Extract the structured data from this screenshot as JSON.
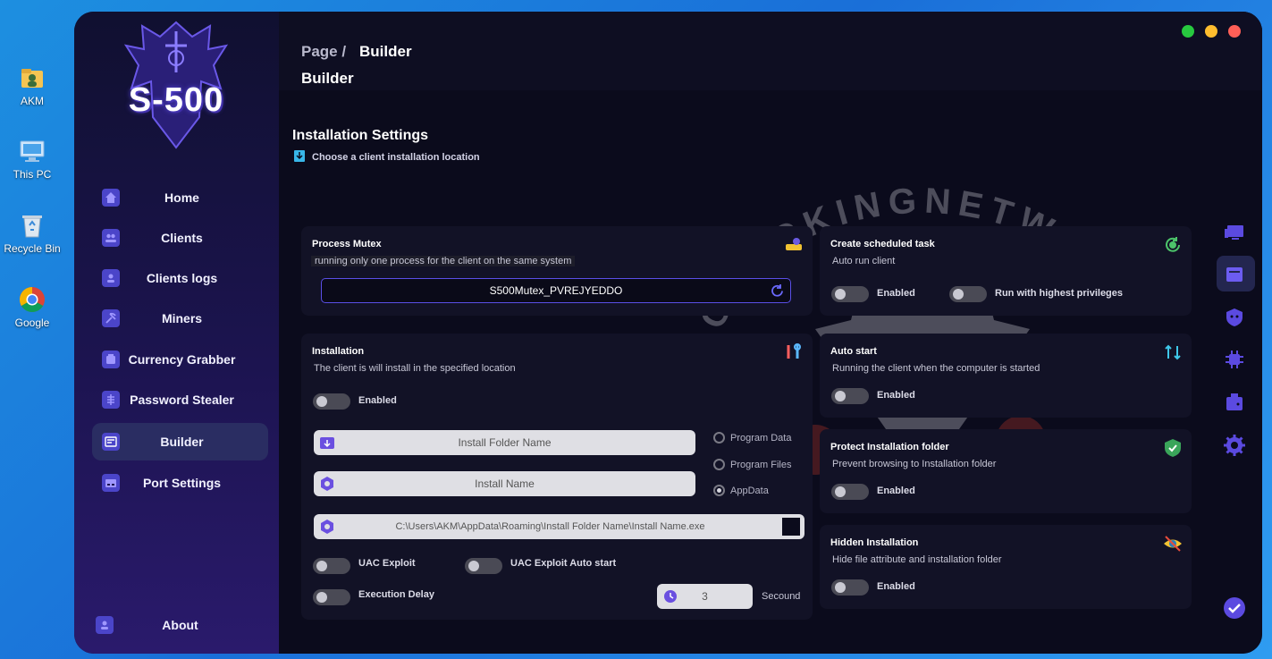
{
  "desktop": {
    "icons": [
      {
        "label": "AKM",
        "icon": "user-folder-icon"
      },
      {
        "label": "This PC",
        "icon": "computer-icon"
      },
      {
        "label": "Recycle Bin",
        "icon": "recycle-bin-icon"
      },
      {
        "label": "Google",
        "icon": "chrome-icon"
      }
    ]
  },
  "app": {
    "logo_text": "S-500",
    "colors": {
      "accent": "#4b45c9",
      "sidebar_active": "#2a2d62",
      "window_bg": "#0b0b1c",
      "card_bg": "#121226"
    },
    "window_controls": {
      "green": "#27c93f",
      "yellow": "#ffbd2e",
      "red": "#ff5f57"
    }
  },
  "sidebar": {
    "items": [
      {
        "label": "Home",
        "icon": "home-icon"
      },
      {
        "label": "Clients",
        "icon": "users-icon"
      },
      {
        "label": "Clients logs",
        "icon": "logs-icon"
      },
      {
        "label": "Miners",
        "icon": "miner-icon"
      },
      {
        "label": "Currency Grabber",
        "icon": "wallet-icon"
      },
      {
        "label": "Password Stealer",
        "icon": "key-icon"
      },
      {
        "label": "Builder",
        "icon": "builder-icon",
        "active": true
      },
      {
        "label": "Port Settings",
        "icon": "port-icon"
      }
    ],
    "about": "About"
  },
  "header": {
    "breadcrumb_prefix": "Page /",
    "breadcrumb_current": "Builder",
    "page_title": "Builder"
  },
  "section": {
    "title": "Installation Settings",
    "subtitle": "Choose a client installation location"
  },
  "mutex": {
    "title": "Process Mutex",
    "desc": "running only one process for the client on the same system",
    "value": "S500Mutex_PVREJYEDDO"
  },
  "installation": {
    "title": "Installation",
    "desc": "The client is will install in the specified location",
    "enabled_label": "Enabled",
    "folder_placeholder": "Install Folder Name",
    "name_placeholder": "Install Name",
    "path": "C:\\Users\\AKM\\AppData\\Roaming\\Install Folder Name\\Install Name.exe",
    "locations": [
      "Program Data",
      "Program Files",
      "AppData"
    ],
    "selected_location": "AppData",
    "uac_exploit": "UAC Exploit",
    "uac_exploit_auto": "UAC Exploit Auto start",
    "execution_delay": "Execution Delay",
    "delay_value": "3",
    "delay_unit": "Secound"
  },
  "scheduled": {
    "title": "Create scheduled task",
    "desc": "Auto run client",
    "enabled_label": "Enabled",
    "privileges_label": "Run with highest privileges"
  },
  "autostart": {
    "title": "Auto start",
    "desc": "Running the client when the computer is started",
    "enabled_label": "Enabled"
  },
  "protect": {
    "title": "Protect Installation folder",
    "desc": "Prevent browsing to Installation folder",
    "enabled_label": "Enabled"
  },
  "hidden": {
    "title": "Hidden Installation",
    "desc": "Hide file attribute and installation folder",
    "enabled_label": "Enabled"
  },
  "watermark": {
    "arc_text": "CRACKINGNETWORK",
    "label": "AKM"
  }
}
